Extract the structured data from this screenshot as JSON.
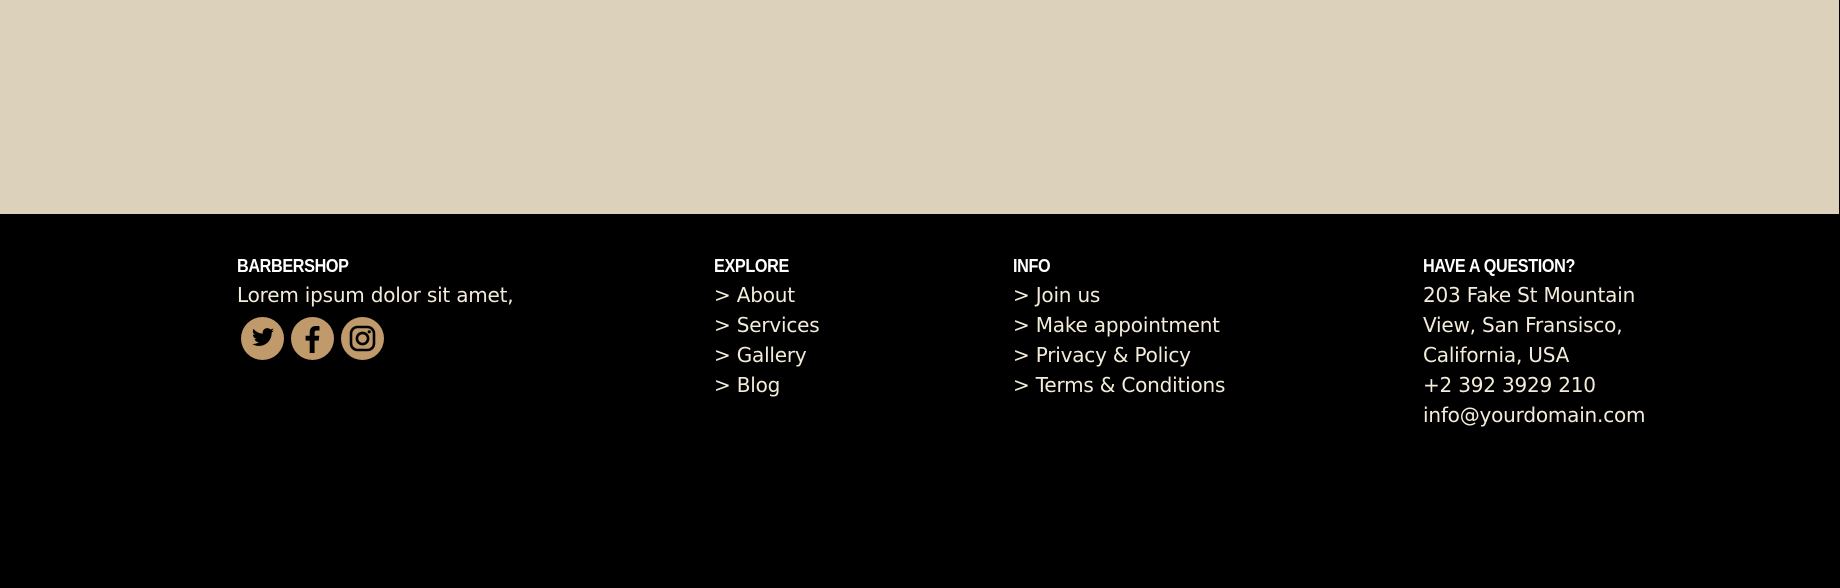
{
  "colors": {
    "top_band": "#dcd2bb",
    "footer_bg": "#000000",
    "accent": "#c19a6b",
    "text": "#f3ecda",
    "heading": "#ffffff"
  },
  "brand": {
    "heading": "BARBERSHOP",
    "text": "Lorem ipsum dolor sit amet,",
    "social": [
      {
        "icon": "twitter-icon"
      },
      {
        "icon": "facebook-icon"
      },
      {
        "icon": "instagram-icon"
      }
    ]
  },
  "explore": {
    "heading": "EXPLORE",
    "links": [
      "> About",
      "> Services",
      "> Gallery",
      "> Blog"
    ]
  },
  "info": {
    "heading": "INFO",
    "links": [
      "> Join us",
      "> Make appointment",
      "> Privacy & Policy",
      "> Terms & Conditions"
    ]
  },
  "contact": {
    "heading": "HAVE A QUESTION?",
    "address_lines": [
      "203 Fake St Mountain",
      "View, San Fransisco,",
      "California, USA"
    ],
    "phone": "+2 392 3929 210",
    "email": "info@yourdomain.com"
  }
}
